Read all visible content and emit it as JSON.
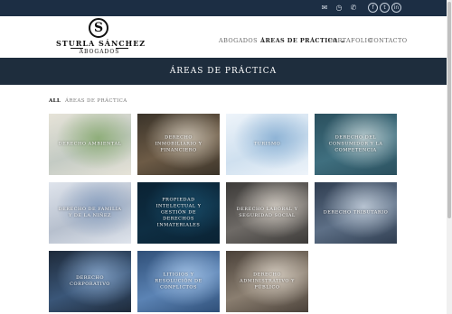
{
  "topbar": {
    "icons": [
      {
        "name": "mail-icon",
        "glyph": "✉"
      },
      {
        "name": "clock-icon",
        "glyph": "◷"
      },
      {
        "name": "phone-icon",
        "glyph": "✆"
      },
      {
        "name": "facebook-icon",
        "glyph": "f"
      },
      {
        "name": "twitter-icon",
        "glyph": "t"
      },
      {
        "name": "linkedin-icon",
        "glyph": "in"
      }
    ]
  },
  "logo": {
    "mark": "S",
    "name": "STURLA SÁNCHEZ",
    "sub": "ABOGADOS"
  },
  "nav": {
    "items": [
      "ABOGADOS",
      "ÁREAS DE PRÁCTICA",
      "PORTAFOLIO",
      "CONTACTO"
    ],
    "dropdown_glyph": "⌄",
    "active_index": 1
  },
  "banner": {
    "title": "ÁREAS DE PRÁCTICA"
  },
  "filters": {
    "all": "ALL",
    "area": "ÁREAS DE PRÁCTICA"
  },
  "tiles": [
    {
      "label": "DERECHO AMBIENTAL",
      "colors": [
        "#c4cbc4",
        "#8fae7a",
        "#e6e3d8"
      ]
    },
    {
      "label": "DERECHO INMOBILIARIO Y FINANCIERO",
      "colors": [
        "#6d5b46",
        "#c2b9aa",
        "#3a3329"
      ]
    },
    {
      "label": "TURISMO",
      "colors": [
        "#cfe0ef",
        "#8fb4d6",
        "#eef4fa"
      ]
    },
    {
      "label": "DERECHO DEL CONSUMIDOR Y LA COMPETENCIA",
      "colors": [
        "#3f6f7f",
        "#b5c8cc",
        "#2a4f5d"
      ]
    },
    {
      "label": "DERECHO DE FAMILIA Y DE LA NIÑEZ",
      "colors": [
        "#b7c0ce",
        "#8aa0bf",
        "#dfe4ec"
      ]
    },
    {
      "label": "PROPIEDAD INTELECTUAL Y GESTIÓN DE DERECHOS INMATERIALES",
      "colors": [
        "#0e2e43",
        "#184a66",
        "#0a2233"
      ]
    },
    {
      "label": "DERECHO LABORAL Y SEGURIDAD SOCIAL",
      "colors": [
        "#6e6a66",
        "#c9c3bb",
        "#3c3a38"
      ]
    },
    {
      "label": "DERECHO TRIBUTARIO",
      "colors": [
        "#5d6f86",
        "#b7c3d1",
        "#2f3d50"
      ]
    },
    {
      "label": "DERECHO CORPORATIVO",
      "colors": [
        "#3a5678",
        "#7d9bbf",
        "#1e2a3a"
      ]
    },
    {
      "label": "LITIGIOS Y RESOLUCIÓN DE CONFLICTOS",
      "colors": [
        "#5b83b4",
        "#9bbbe0",
        "#2f4f78"
      ]
    },
    {
      "label": "DERECHO ADMINISTRATIVO Y PÚBLICO",
      "colors": [
        "#8a7e70",
        "#cfc6ba",
        "#4a4139"
      ]
    }
  ],
  "colors": {
    "topbar": "#1c2e44",
    "banner": "#1e2d3d",
    "accent": "#ffffff"
  }
}
